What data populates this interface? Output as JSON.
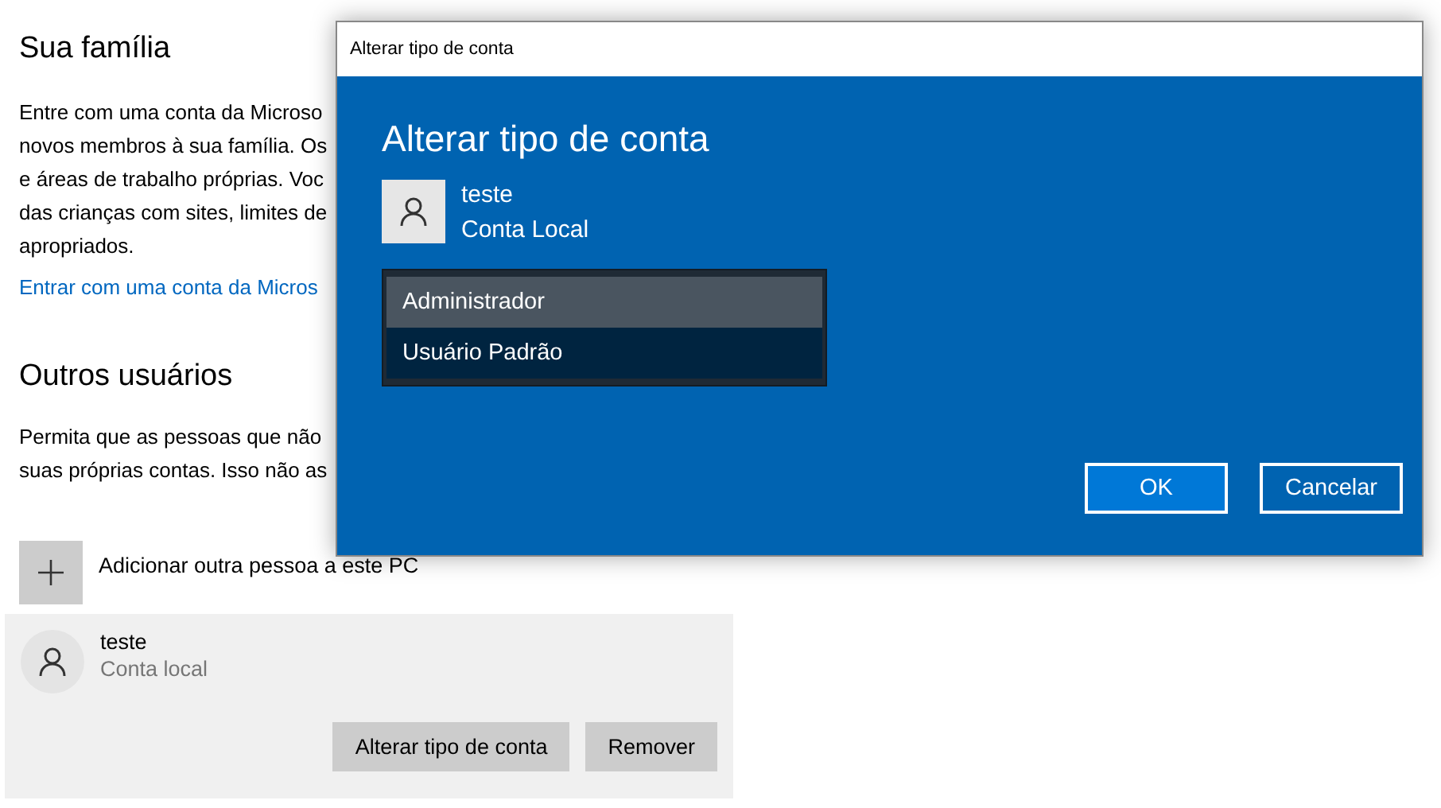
{
  "family": {
    "heading": "Sua família",
    "lines": [
      "Entre com uma conta da Microso",
      "novos membros à sua família. Os",
      "e áreas de trabalho próprias. Voc",
      "das crianças com sites, limites de",
      "apropriados."
    ],
    "link": "Entrar com uma conta da Micros"
  },
  "others": {
    "heading": "Outros usuários",
    "lines": [
      "Permita que as pessoas que não",
      "suas próprias contas. Isso não as"
    ],
    "add_label": "Adicionar outra pessoa a este PC",
    "user": {
      "name": "teste",
      "type": "Conta local",
      "selected": true,
      "buttons": [
        "Alterar tipo de conta",
        "Remover"
      ]
    }
  },
  "dialog": {
    "title": "Alterar tipo de conta",
    "heading": "Alterar tipo de conta",
    "user": {
      "name": "teste",
      "type": "Conta Local"
    },
    "options": [
      {
        "label": "Administrador",
        "selected": true
      },
      {
        "label": "Usuário Padrão",
        "selected": false
      }
    ],
    "buttons": [
      {
        "label": "OK",
        "kind": "primary"
      },
      {
        "label": "Cancelar",
        "kind": "secondary"
      }
    ]
  }
}
